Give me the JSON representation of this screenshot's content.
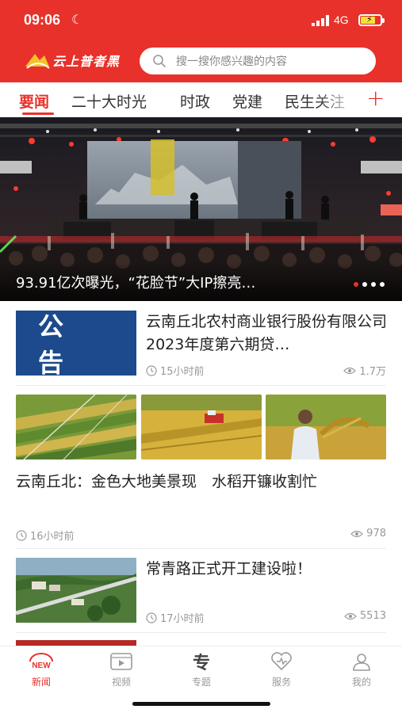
{
  "status_bar": {
    "time": "09:06",
    "network": "4G"
  },
  "header": {
    "logo_text": "云上普者黑",
    "search_placeholder": "搜一搜你感兴趣的内容"
  },
  "tabs": [
    {
      "label": "要闻",
      "active": true
    },
    {
      "label": "二十大时光",
      "active": false
    },
    {
      "label": "时政",
      "active": false
    },
    {
      "label": "党建",
      "active": false
    },
    {
      "label": "民生关注",
      "active": false
    }
  ],
  "hero": {
    "caption": "93.91亿次曝光，“花脸节”大IP擦亮…",
    "slide_count": 4,
    "active_slide": 1
  },
  "articles": [
    {
      "thumb_text": "公 告",
      "title": "云南丘北农村商业银行股份有限公司2023年度第六期贷…",
      "time": "15小时前",
      "views": "1.7万"
    },
    {
      "title": "云南丘北：金色大地美景现　水稻开镰收割忙",
      "time": "16小时前",
      "views": "978"
    },
    {
      "title": "常青路正式开工建设啦！",
      "time": "17小时前",
      "views": "5513"
    }
  ],
  "bottom_nav": [
    {
      "label": "新闻",
      "icon": "news-new-icon",
      "active": true
    },
    {
      "label": "视频",
      "icon": "video-icon",
      "active": false
    },
    {
      "label": "专题",
      "icon": "topic-icon",
      "active": false
    },
    {
      "label": "服务",
      "icon": "service-heart-icon",
      "active": false
    },
    {
      "label": "我的",
      "icon": "user-icon",
      "active": false
    }
  ],
  "colors": {
    "brand_red": "#e8312a",
    "notice_blue": "#1c4a8c"
  }
}
